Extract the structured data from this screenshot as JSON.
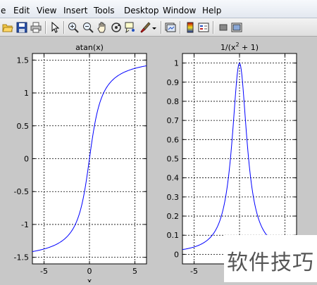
{
  "menu": {
    "items": [
      "e",
      "Edit",
      "View",
      "Insert",
      "Tools",
      "Desktop",
      "Window",
      "Help"
    ]
  },
  "toolbar": {
    "icons": [
      "open-file-icon",
      "save-icon",
      "print-icon",
      "select-arrow-icon",
      "zoom-in-icon",
      "zoom-out-icon",
      "pan-hand-icon",
      "rotate-3d-icon",
      "data-cursor-icon",
      "brush-icon",
      "dropdown-arrow-icon",
      "link-plot-icon",
      "colorbar-icon",
      "legend-icon",
      "hide-plot-tools-icon",
      "show-plot-tools-icon"
    ]
  },
  "chart_data": [
    {
      "type": "line",
      "title": "atan(x)",
      "function": "atan(x)",
      "x": [
        -6.28,
        -5,
        -4,
        -3,
        -2,
        -1.5,
        -1,
        -0.5,
        0,
        0.5,
        1,
        1.5,
        2,
        3,
        4,
        5,
        6.28
      ],
      "y": [
        -1.413,
        -1.3734,
        -1.3258,
        -1.249,
        -1.1071,
        -0.9828,
        -0.7854,
        -0.4636,
        0,
        0.4636,
        0.7854,
        0.9828,
        1.1071,
        1.249,
        1.3258,
        1.3734,
        1.413
      ],
      "xlim": [
        -6.28,
        6.28
      ],
      "ylim": [
        -1.6,
        1.6
      ],
      "xticks": [
        -5,
        0,
        5
      ],
      "yticks": [
        -1.5,
        -1,
        -0.5,
        0,
        0.5,
        1,
        1.5
      ],
      "xtick_labels": [
        "-5",
        "0",
        "5"
      ],
      "ytick_labels": [
        "-1.5",
        "-1",
        "-0.5",
        "0",
        "0.5",
        "1",
        "1.5"
      ],
      "xlabel": "x",
      "grid": true,
      "line_color": "#0000ff"
    },
    {
      "type": "line",
      "title": "1/(x2 + 1)",
      "title_base": "1/(x",
      "title_sup": "2",
      "title_rest": " + 1)",
      "function": "1/(x^2+1)",
      "x": [
        -6.28,
        -5,
        -4,
        -3,
        -2,
        -1.5,
        -1,
        -0.5,
        0,
        0.5,
        1,
        1.5,
        2,
        3,
        4,
        5,
        6.28
      ],
      "y": [
        0.0248,
        0.0385,
        0.0588,
        0.1,
        0.2,
        0.3077,
        0.5,
        0.8,
        1,
        0.8,
        0.5,
        0.3077,
        0.2,
        0.1,
        0.0588,
        0.0385,
        0.0248
      ],
      "xlim": [
        -6.28,
        6.28
      ],
      "ylim": [
        -0.05,
        1.05
      ],
      "xticks": [
        -5,
        0,
        5
      ],
      "yticks": [
        0,
        0.1,
        0.2,
        0.3,
        0.4,
        0.5,
        0.6,
        0.7,
        0.8,
        0.9,
        1
      ],
      "xtick_labels": [
        "-5"
      ],
      "ytick_labels": [
        "0",
        "0.1",
        "0.2",
        "0.3",
        "0.4",
        "0.5",
        "0.6",
        "0.7",
        "0.8",
        "0.9",
        "1"
      ],
      "grid": true,
      "line_color": "#0000ff"
    }
  ],
  "watermark": {
    "text": "软件技巧"
  }
}
